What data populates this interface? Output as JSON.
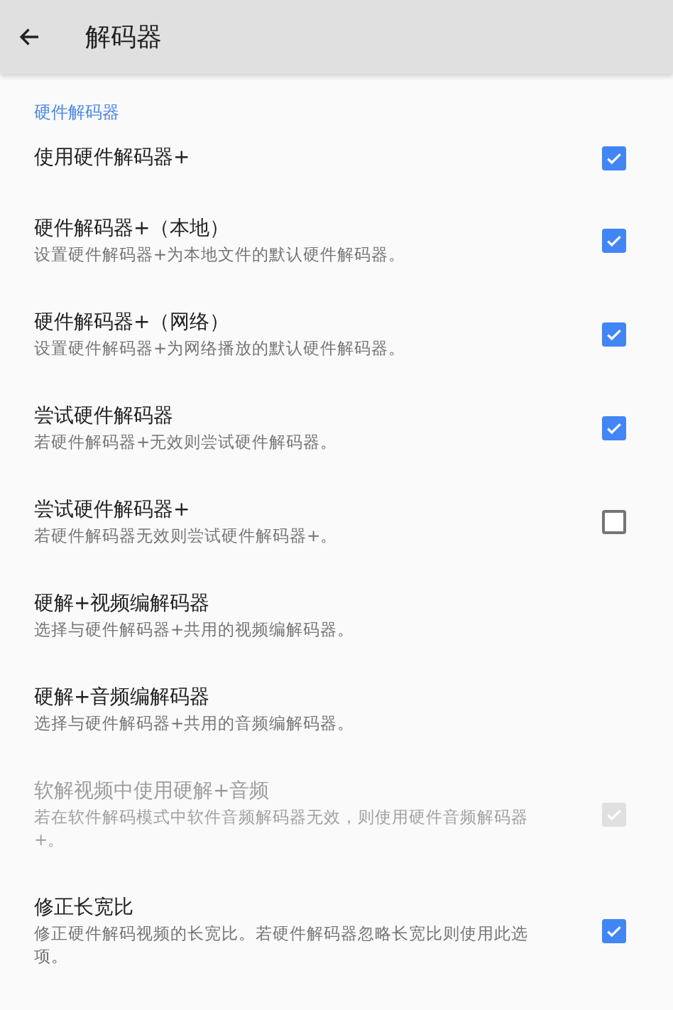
{
  "app_bar": {
    "title": "解码器"
  },
  "section": {
    "title": "硬件解码器"
  },
  "items": [
    {
      "title": "使用硬件解码器+",
      "checked": true,
      "disabled": false
    },
    {
      "title": "硬件解码器+（本地）",
      "summary": "设置硬件解码器+为本地文件的默认硬件解码器。",
      "checked": true,
      "disabled": false
    },
    {
      "title": "硬件解码器+（网络）",
      "summary": "设置硬件解码器+为网络播放的默认硬件解码器。",
      "checked": true,
      "disabled": false
    },
    {
      "title": "尝试硬件解码器",
      "summary": "若硬件解码器+无效则尝试硬件解码器。",
      "checked": true,
      "disabled": false
    },
    {
      "title": "尝试硬件解码器+",
      "summary": "若硬件解码器无效则尝试硬件解码器+。",
      "checked": false,
      "disabled": false
    },
    {
      "title": "硬解+视频编解码器",
      "summary": "选择与硬件解码器+共用的视频编解码器。",
      "disabled": false
    },
    {
      "title": "硬解+音频编解码器",
      "summary": "选择与硬件解码器+共用的音频编解码器。",
      "disabled": false
    },
    {
      "title": "软解视频中使用硬解+音频",
      "summary": "若在软件解码模式中软件音频解码器无效，则使用硬件音频解码器+。",
      "checked": true,
      "disabled": true
    },
    {
      "title": "修正长宽比",
      "summary": "修正硬件解码视频的长宽比。若硬件解码器忽略长宽比则使用此选项。",
      "checked": true,
      "disabled": false
    }
  ]
}
